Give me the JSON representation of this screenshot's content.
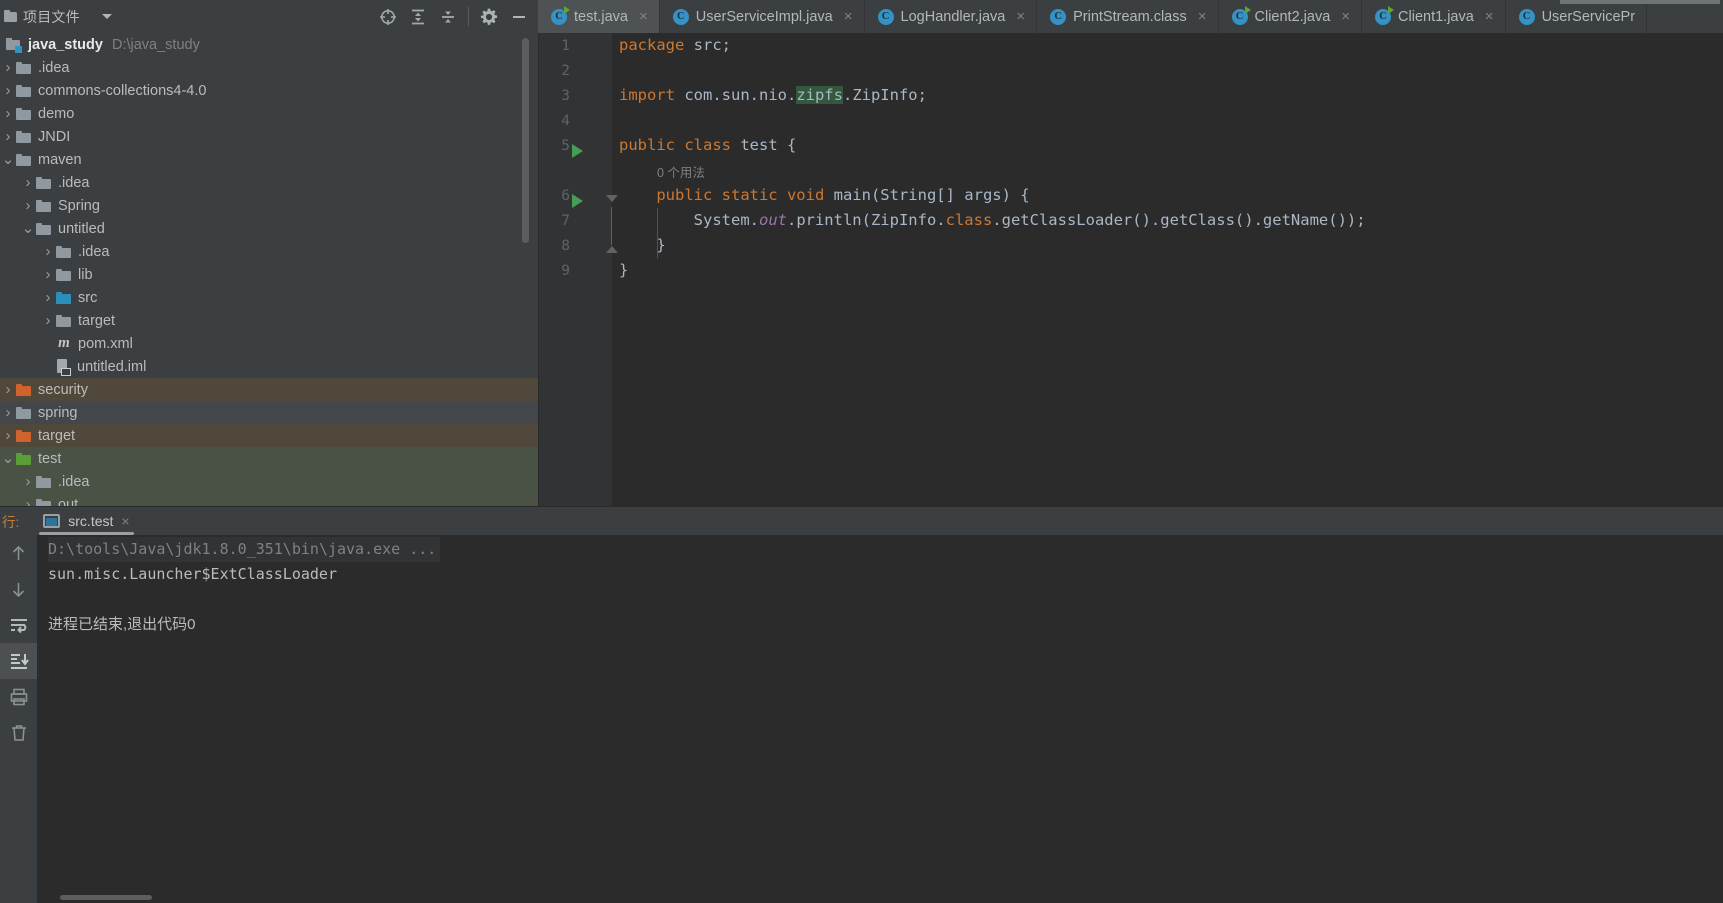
{
  "window": {
    "project_panel_title": "项目文件",
    "toolbar_icons": [
      "locate-icon",
      "expand-all-icon",
      "collapse-all-icon",
      "gear-icon",
      "minimize-icon"
    ]
  },
  "tabs": [
    {
      "label": "test.java",
      "icon": "class-run-icon",
      "active": true,
      "close": "×"
    },
    {
      "label": "UserServiceImpl.java",
      "icon": "class-icon",
      "active": false,
      "close": "×"
    },
    {
      "label": "LogHandler.java",
      "icon": "class-icon",
      "active": false,
      "close": "×"
    },
    {
      "label": "PrintStream.class",
      "icon": "class-icon",
      "active": false,
      "close": "×"
    },
    {
      "label": "Client2.java",
      "icon": "class-run-icon",
      "active": false,
      "close": "×"
    },
    {
      "label": "Client1.java",
      "icon": "class-run-icon",
      "active": false,
      "close": "×"
    },
    {
      "label": "UserServicePr",
      "icon": "class-icon",
      "active": false,
      "close": ""
    }
  ],
  "tree": {
    "root": {
      "label": "java_study",
      "path": "D:\\java_study"
    },
    "items": [
      {
        "label": ".idea",
        "depth": 1,
        "arrow": ">",
        "folder": "gray",
        "hl": "none"
      },
      {
        "label": "commons-collections4-4.0",
        "depth": 1,
        "arrow": ">",
        "folder": "gray",
        "hl": "none"
      },
      {
        "label": "demo",
        "depth": 1,
        "arrow": ">",
        "folder": "gray",
        "hl": "none"
      },
      {
        "label": "JNDI",
        "depth": 1,
        "arrow": ">",
        "folder": "gray",
        "hl": "none"
      },
      {
        "label": "maven",
        "depth": 1,
        "arrow": "v",
        "folder": "gray",
        "hl": "none"
      },
      {
        "label": ".idea",
        "depth": 2,
        "arrow": ">",
        "folder": "gray",
        "hl": "none"
      },
      {
        "label": "Spring",
        "depth": 2,
        "arrow": ">",
        "folder": "gray",
        "hl": "none"
      },
      {
        "label": "untitled",
        "depth": 2,
        "arrow": "v",
        "folder": "gray",
        "hl": "none"
      },
      {
        "label": ".idea",
        "depth": 3,
        "arrow": ">",
        "folder": "gray",
        "hl": "none"
      },
      {
        "label": "lib",
        "depth": 3,
        "arrow": ">",
        "folder": "gray",
        "hl": "none"
      },
      {
        "label": "src",
        "depth": 3,
        "arrow": ">",
        "folder": "blue",
        "hl": "none"
      },
      {
        "label": "target",
        "depth": 3,
        "arrow": ">",
        "folder": "gray",
        "hl": "none"
      },
      {
        "label": "pom.xml",
        "depth": 3,
        "arrow": "",
        "folder": "maven",
        "hl": "none"
      },
      {
        "label": "untitled.iml",
        "depth": 3,
        "arrow": "",
        "folder": "iml",
        "hl": "none"
      },
      {
        "label": "security",
        "depth": 1,
        "arrow": ">",
        "folder": "orange",
        "hl": "brown"
      },
      {
        "label": "spring",
        "depth": 1,
        "arrow": ">",
        "folder": "gray",
        "hl": "dark"
      },
      {
        "label": "target",
        "depth": 1,
        "arrow": ">",
        "folder": "orange",
        "hl": "brown"
      },
      {
        "label": "test",
        "depth": 1,
        "arrow": "v",
        "folder": "green",
        "hl": "green"
      },
      {
        "label": ".idea",
        "depth": 2,
        "arrow": ">",
        "folder": "gray",
        "hl": "green"
      },
      {
        "label": "out",
        "depth": 2,
        "arrow": ">",
        "folder": "gray",
        "hl": "green"
      }
    ]
  },
  "editor": {
    "line_numbers": [
      "1",
      "2",
      "3",
      "4",
      "5",
      "6",
      "7",
      "8",
      "9"
    ],
    "usage_hint": "0 个用法",
    "lines": [
      {
        "n": 1,
        "segments": [
          {
            "t": "package ",
            "c": "kw"
          },
          {
            "t": "src;",
            "c": "plain"
          }
        ]
      },
      {
        "n": 2,
        "segments": []
      },
      {
        "n": 3,
        "segments": [
          {
            "t": "import ",
            "c": "kw"
          },
          {
            "t": "com.sun.nio.",
            "c": "plain"
          },
          {
            "t": "zipfs",
            "c": "mark"
          },
          {
            "t": ".ZipInfo;",
            "c": "plain"
          }
        ]
      },
      {
        "n": 4,
        "segments": []
      },
      {
        "n": 5,
        "segments": [
          {
            "t": "public class ",
            "c": "kw"
          },
          {
            "t": "test {",
            "c": "plain"
          }
        ]
      },
      {
        "n": 6,
        "segments": [
          {
            "t": "    ",
            "c": "plain"
          },
          {
            "t": "public static void ",
            "c": "kw"
          },
          {
            "t": "main(String[] args) {",
            "c": "plain"
          }
        ]
      },
      {
        "n": 7,
        "segments": [
          {
            "t": "        System.",
            "c": "plain"
          },
          {
            "t": "out",
            "c": "field"
          },
          {
            "t": ".println(ZipInfo.",
            "c": "plain"
          },
          {
            "t": "class",
            "c": "kw"
          },
          {
            "t": ".getClassLoader().getClass().getName());",
            "c": "plain"
          }
        ]
      },
      {
        "n": 8,
        "segments": [
          {
            "t": "    }",
            "c": "plain"
          }
        ]
      },
      {
        "n": 9,
        "segments": [
          {
            "t": "}",
            "c": "plain"
          }
        ]
      }
    ]
  },
  "console": {
    "panel_label": "行:",
    "tab_label": "src.test",
    "tab_close": "×",
    "output": [
      {
        "text": "D:\\tools\\Java\\jdk1.8.0_351\\bin\\java.exe ...",
        "style": "cmd"
      },
      {
        "text": "sun.misc.Launcher$ExtClassLoader",
        "style": "out"
      },
      {
        "text": "",
        "style": "out"
      },
      {
        "text": "进程已结束,退出代码0",
        "style": "cn"
      }
    ],
    "side_icons": [
      "arrow-up-icon",
      "arrow-down-icon",
      "soft-wrap-icon",
      "scroll-to-end-icon",
      "print-icon",
      "trash-icon"
    ]
  },
  "colors": {
    "accent_blue": "#3592c4",
    "run_green": "#499c54",
    "keyword_orange": "#cc7832",
    "text": "#a9b7c6",
    "panel_bg": "#3c3f41",
    "editor_bg": "#2b2b2b"
  }
}
